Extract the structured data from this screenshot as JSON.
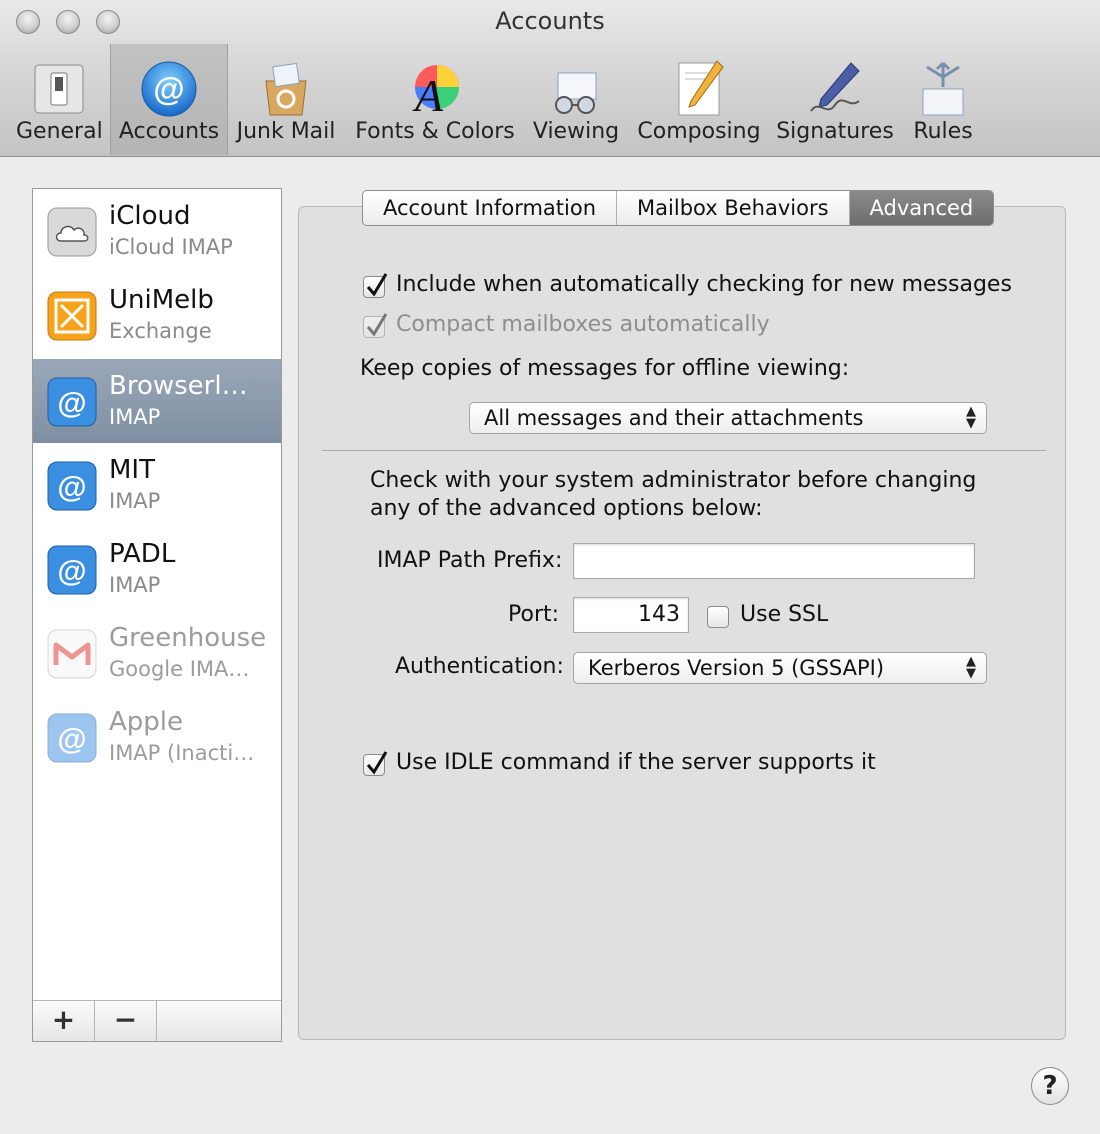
{
  "window": {
    "title": "Accounts"
  },
  "toolbar": {
    "items": [
      {
        "label": "General",
        "icon": "general-switch-icon"
      },
      {
        "label": "Accounts",
        "icon": "at-sign-icon",
        "active": true
      },
      {
        "label": "Junk Mail",
        "icon": "junk-mail-icon"
      },
      {
        "label": "Fonts & Colors",
        "icon": "fonts-colors-icon"
      },
      {
        "label": "Viewing",
        "icon": "viewing-glasses-icon"
      },
      {
        "label": "Composing",
        "icon": "composing-pencil-icon"
      },
      {
        "label": "Signatures",
        "icon": "signature-pen-icon"
      },
      {
        "label": "Rules",
        "icon": "rules-icon"
      }
    ]
  },
  "accounts": [
    {
      "name": "iCloud",
      "type": "iCloud IMAP",
      "icon": "icloud-icon"
    },
    {
      "name": "UniMelb",
      "type": "Exchange",
      "icon": "exchange-icon"
    },
    {
      "name": "Browserl…",
      "type": "IMAP",
      "icon": "at-sign-icon",
      "selected": true
    },
    {
      "name": "MIT",
      "type": "IMAP",
      "icon": "at-sign-icon"
    },
    {
      "name": "PADL",
      "type": "IMAP",
      "icon": "at-sign-icon"
    },
    {
      "name": "Greenhouse",
      "type": "Google IMA…",
      "icon": "gmail-icon",
      "inactive": true
    },
    {
      "name": "Apple",
      "type": "IMAP (Inacti…",
      "icon": "at-sign-icon",
      "inactive": true
    }
  ],
  "list_footer": {
    "add": "+",
    "remove": "−"
  },
  "tabs": [
    {
      "label": "Account Information"
    },
    {
      "label": "Mailbox Behaviors"
    },
    {
      "label": "Advanced",
      "active": true
    }
  ],
  "advanced": {
    "include_checking": {
      "label": "Include when automatically checking for new messages",
      "checked": true
    },
    "compact_mailboxes": {
      "label": "Compact mailboxes automatically",
      "checked": true,
      "disabled": true
    },
    "keep_copies_label": "Keep copies of messages for offline viewing:",
    "keep_copies_value": "All messages and their attachments",
    "admin_note_line1": "Check with your system administrator before changing",
    "admin_note_line2": "any of the advanced options below:",
    "imap_prefix_label": "IMAP Path Prefix:",
    "imap_prefix_value": "",
    "port_label": "Port:",
    "port_value": "143",
    "use_ssl": {
      "label": "Use SSL",
      "checked": false
    },
    "auth_label": "Authentication:",
    "auth_value": "Kerberos Version 5 (GSSAPI)",
    "idle": {
      "label": "Use IDLE command if the server supports it",
      "checked": true
    }
  },
  "help": {
    "label": "?"
  },
  "colors": {
    "selection": "#8394a8",
    "accent_blue": "#2f8be0"
  }
}
